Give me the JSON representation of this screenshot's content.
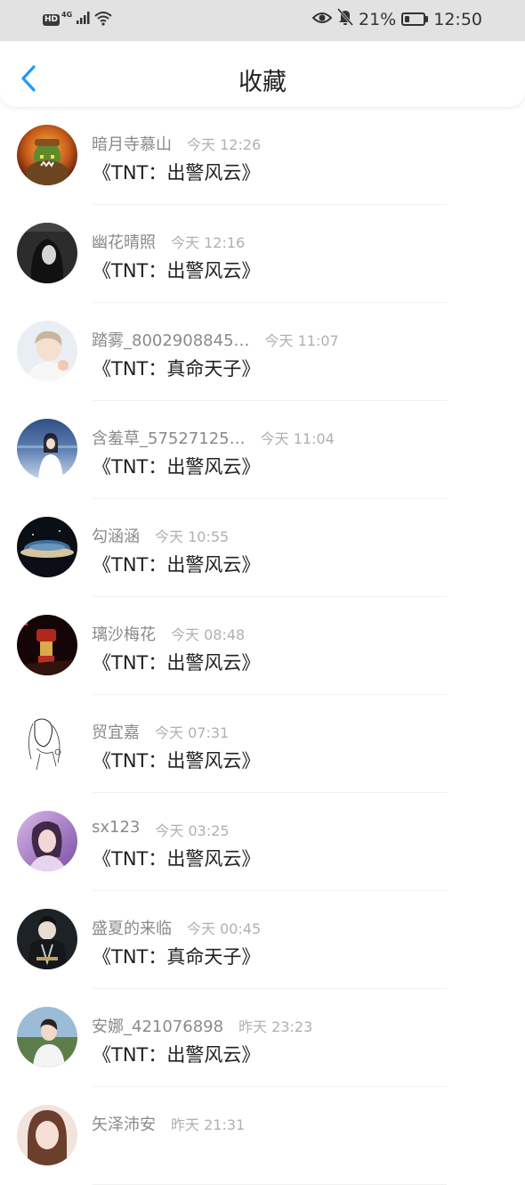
{
  "status_bar": {
    "hd": "HD",
    "network": "4G",
    "battery_percent": "21%",
    "time": "12:50",
    "battery_level": 0.21,
    "icons": [
      "hd-icon",
      "signal-icon",
      "wifi-icon",
      "eye-icon",
      "bell-mute-icon",
      "battery-icon"
    ]
  },
  "header": {
    "back_icon": "chevron-left-icon",
    "title": "收藏",
    "accent_color": "#1e9cf0"
  },
  "items": [
    {
      "name": "暗月寺慕山",
      "time": "今天 12:26",
      "work": "《TNT：出警风云》",
      "avatar": "avatar-orc"
    },
    {
      "name": "幽花晴照",
      "time": "今天 12:16",
      "work": "《TNT：出警风云》",
      "avatar": "avatar-dark-girl"
    },
    {
      "name": "踏雾_8002908845…",
      "time": "今天 11:07",
      "work": "《TNT：真命天子》",
      "avatar": "avatar-boy-light"
    },
    {
      "name": "含羞草_57527125…",
      "time": "今天 11:04",
      "work": "《TNT：出警风云》",
      "avatar": "avatar-sea-girl"
    },
    {
      "name": "勾涵涵",
      "time": "今天 10:55",
      "work": "《TNT：出警风云》",
      "avatar": "avatar-night-sky"
    },
    {
      "name": "璃沙梅花",
      "time": "今天 08:48",
      "work": "《TNT：出警风云》",
      "avatar": "avatar-red-lantern"
    },
    {
      "name": "贸宜嘉",
      "time": "今天 07:31",
      "work": "《TNT：出警风云》",
      "avatar": "avatar-sketch"
    },
    {
      "name": "sx123",
      "time": "今天 03:25",
      "work": "《TNT：出警风云》",
      "avatar": "avatar-purple-girl"
    },
    {
      "name": "盛夏的来临",
      "time": "今天 00:45",
      "work": "《TNT：真命天子》",
      "avatar": "avatar-costume"
    },
    {
      "name": "安娜_421076898",
      "time": "昨天 23:23",
      "work": "《TNT：出警风云》",
      "avatar": "avatar-boy-outdoor"
    },
    {
      "name": "矢泽沛安",
      "time": "昨天 21:31",
      "work": "",
      "avatar": "avatar-girl-partial"
    }
  ]
}
